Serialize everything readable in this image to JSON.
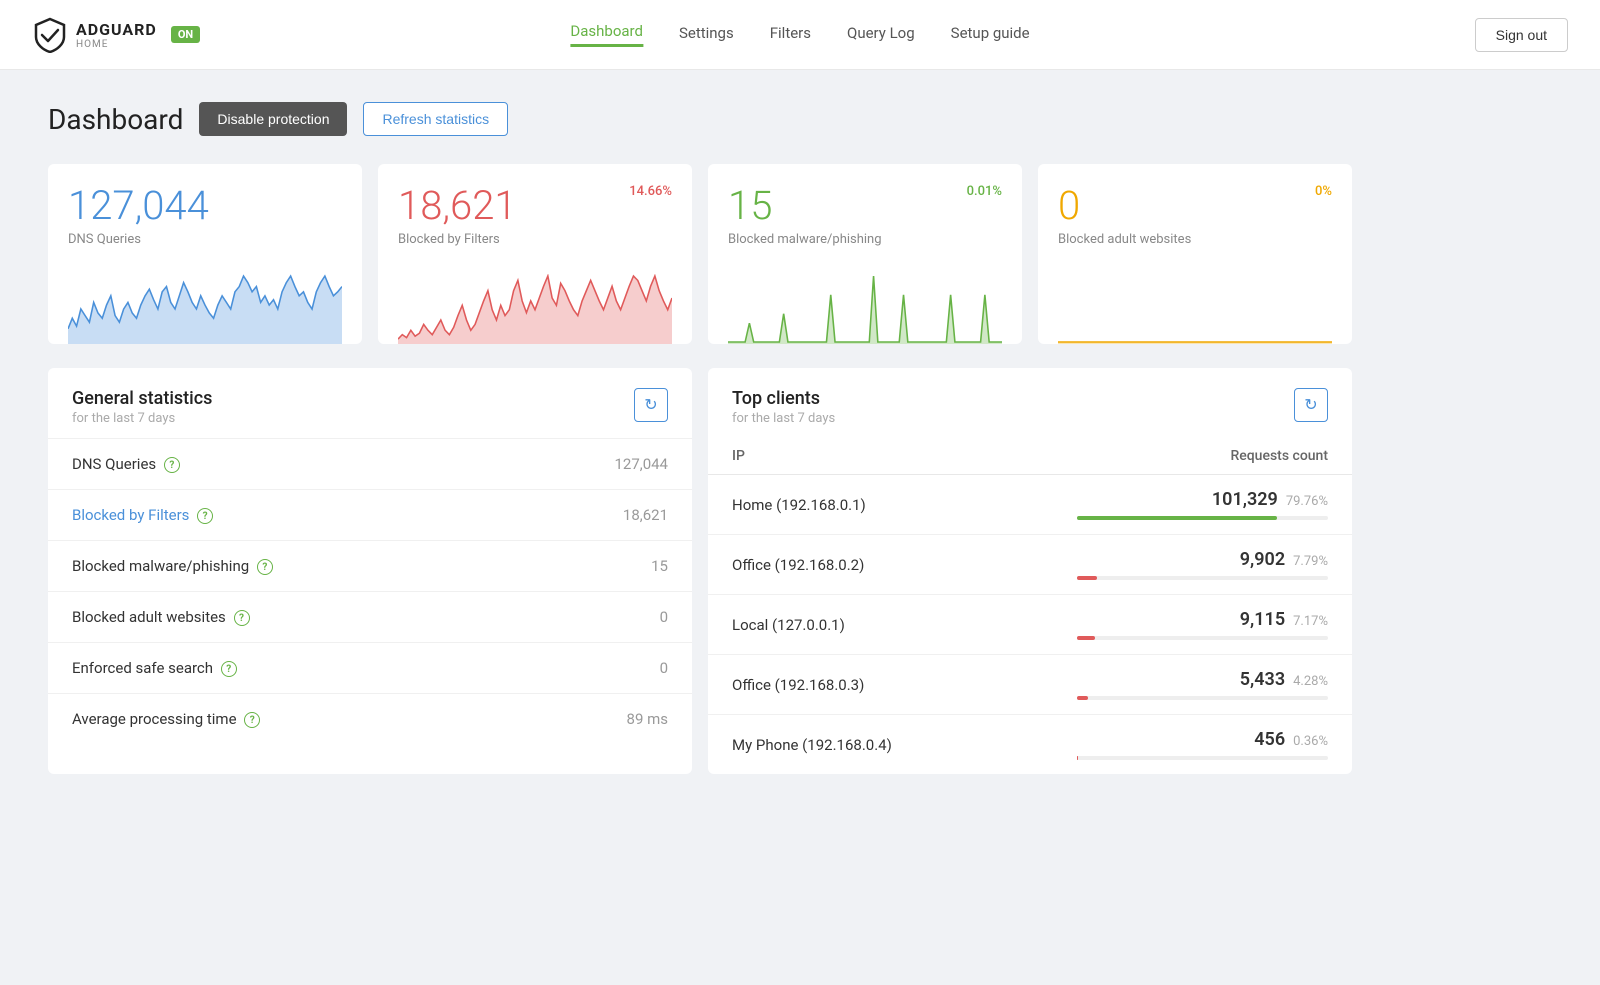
{
  "navbar": {
    "logo_name": "ADGUARD",
    "logo_sub": "HOME",
    "logo_badge": "ON",
    "nav_links": [
      {
        "label": "Dashboard",
        "active": true
      },
      {
        "label": "Settings",
        "active": false
      },
      {
        "label": "Filters",
        "active": false
      },
      {
        "label": "Query Log",
        "active": false
      },
      {
        "label": "Setup guide",
        "active": false
      }
    ],
    "sign_out": "Sign out"
  },
  "header": {
    "title": "Dashboard",
    "btn_disable": "Disable protection",
    "btn_refresh": "Refresh statistics"
  },
  "stat_cards": [
    {
      "number": "127,044",
      "label": "DNS Queries",
      "pct": "",
      "color": "blue",
      "pct_color": "blue"
    },
    {
      "number": "18,621",
      "label": "Blocked by Filters",
      "pct": "14.66%",
      "color": "red",
      "pct_color": "red"
    },
    {
      "number": "15",
      "label": "Blocked malware/phishing",
      "pct": "0.01%",
      "color": "green",
      "pct_color": "green"
    },
    {
      "number": "0",
      "label": "Blocked adult websites",
      "pct": "0%",
      "color": "yellow",
      "pct_color": "yellow"
    }
  ],
  "general_stats": {
    "title": "General statistics",
    "subtitle": "for the last 7 days",
    "rows": [
      {
        "label": "DNS Queries",
        "value": "127,044",
        "is_link": false
      },
      {
        "label": "Blocked by Filters",
        "value": "18,621",
        "is_link": true
      },
      {
        "label": "Blocked malware/phishing",
        "value": "15",
        "is_link": false
      },
      {
        "label": "Blocked adult websites",
        "value": "0",
        "is_link": false
      },
      {
        "label": "Enforced safe search",
        "value": "0",
        "is_link": false
      },
      {
        "label": "Average processing time",
        "value": "89 ms",
        "is_link": false
      }
    ]
  },
  "top_clients": {
    "title": "Top clients",
    "subtitle": "for the last 7 days",
    "col_ip": "IP",
    "col_requests": "Requests count",
    "rows": [
      {
        "name": "Home (192.168.0.1)",
        "count": "101,329",
        "pct": "79.76%",
        "bar_pct": 79.76,
        "bar_color": "green"
      },
      {
        "name": "Office (192.168.0.2)",
        "count": "9,902",
        "pct": "7.79%",
        "bar_pct": 7.79,
        "bar_color": "red"
      },
      {
        "name": "Local (127.0.0.1)",
        "count": "9,115",
        "pct": "7.17%",
        "bar_pct": 7.17,
        "bar_color": "red"
      },
      {
        "name": "Office (192.168.0.3)",
        "count": "5,433",
        "pct": "4.28%",
        "bar_pct": 4.28,
        "bar_color": "red"
      },
      {
        "name": "My Phone (192.168.0.4)",
        "count": "456",
        "pct": "0.36%",
        "bar_pct": 0.36,
        "bar_color": "red"
      }
    ]
  },
  "sparklines": {
    "blue": [
      10,
      18,
      12,
      25,
      20,
      15,
      30,
      22,
      18,
      28,
      35,
      20,
      15,
      25,
      30,
      22,
      18,
      28,
      35,
      40,
      32,
      25,
      38,
      42,
      30,
      25,
      35,
      45,
      38,
      30,
      25,
      35,
      28,
      22,
      18,
      28,
      35,
      30,
      25,
      38,
      42,
      50,
      45,
      38,
      42,
      30,
      35,
      28,
      32,
      25,
      38,
      45,
      50,
      42,
      35,
      38,
      30,
      25,
      38,
      45,
      50,
      42,
      35,
      38,
      42
    ],
    "red": [
      2,
      5,
      3,
      8,
      4,
      6,
      12,
      8,
      5,
      10,
      15,
      8,
      5,
      10,
      18,
      25,
      15,
      8,
      12,
      20,
      28,
      35,
      22,
      15,
      25,
      18,
      22,
      35,
      42,
      28,
      20,
      28,
      22,
      30,
      38,
      45,
      30,
      25,
      40,
      35,
      28,
      22,
      18,
      28,
      35,
      42,
      35,
      28,
      22,
      30,
      38,
      28,
      22,
      30,
      38,
      45,
      42,
      35,
      28,
      38,
      45,
      35,
      28,
      22,
      30
    ],
    "green": [
      0,
      0,
      0,
      0,
      0,
      2,
      0,
      0,
      0,
      0,
      0,
      0,
      0,
      3,
      0,
      0,
      0,
      0,
      0,
      0,
      0,
      0,
      0,
      0,
      5,
      0,
      0,
      0,
      0,
      0,
      0,
      0,
      0,
      0,
      7,
      0,
      0,
      0,
      0,
      0,
      0,
      5,
      0,
      0,
      0,
      0,
      0,
      0,
      0,
      0,
      0,
      0,
      5,
      0,
      0,
      0,
      0,
      0,
      0,
      0,
      5,
      0,
      0,
      0,
      0
    ],
    "yellow": [
      0,
      0,
      0,
      0,
      0,
      0,
      0,
      0,
      0,
      0,
      0,
      0,
      0,
      0,
      0,
      0,
      0,
      0,
      0,
      0,
      0,
      0,
      0,
      0,
      0,
      0,
      0,
      0,
      0,
      0,
      0,
      0,
      0,
      0,
      0,
      0,
      0,
      0,
      0,
      0,
      0,
      0,
      0,
      0,
      0,
      0,
      0,
      0,
      0,
      0,
      0,
      0,
      0,
      0,
      0,
      0,
      0,
      0,
      0,
      0,
      0,
      0,
      0,
      0,
      0
    ]
  }
}
